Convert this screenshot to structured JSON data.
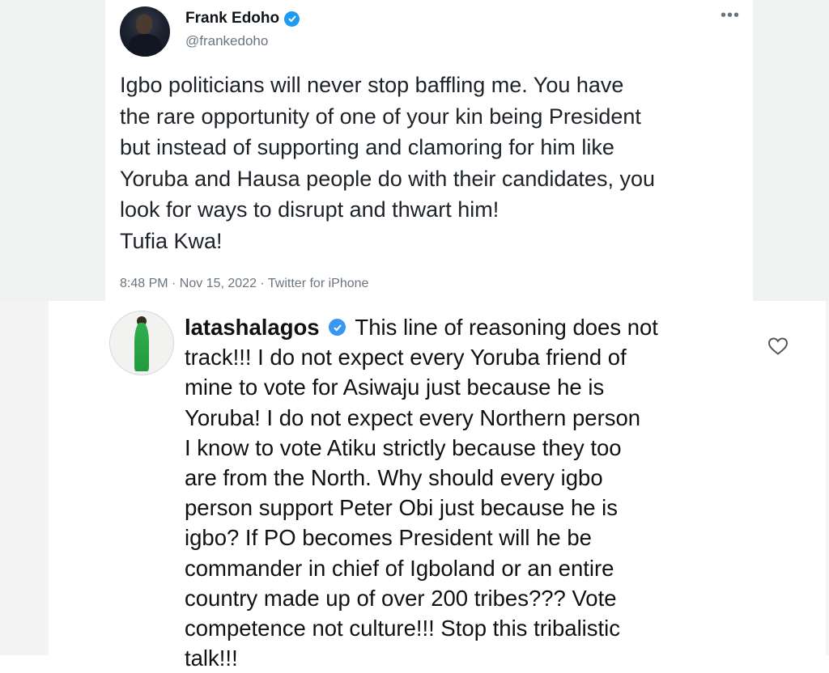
{
  "tweet": {
    "author_name": "Frank Edoho",
    "handle": "@frankedoho",
    "more_icon": "more-horizontal-icon",
    "lines": [
      "Igbo politicians will never stop baffling me. You have",
      "the rare opportunity of one of your kin being President",
      "but instead of supporting and clamoring for him like",
      "Yoruba and Hausa people do with their candidates, you",
      "look for ways to disrupt and thwart him!",
      "Tufia Kwa!"
    ],
    "meta": "8:48 PM · Nov 15, 2022 · Twitter for iPhone"
  },
  "comment": {
    "username": "latashalagos",
    "first_line_text": "This line of reasoning does not",
    "lines": [
      "track!!! I do not expect every Yoruba friend of",
      "mine to vote for Asiwaju just because he is",
      "Yoruba! I do not expect every Northern person",
      "I know to vote Atiku strictly because they too",
      "are from the North. Why should every igbo",
      "person support Peter Obi just because he is",
      "igbo? If PO becomes President will he  be",
      "commander in chief of Igboland or an entire",
      "country made up of over 200 tribes??? Vote",
      "competence not culture!!! Stop this tribalistic",
      "talk!!!"
    ],
    "like_icon": "heart-icon"
  },
  "colors": {
    "twitter_blue": "#1d9bf0",
    "instagram_blue": "#3897f0",
    "muted_text": "#6b7580"
  }
}
